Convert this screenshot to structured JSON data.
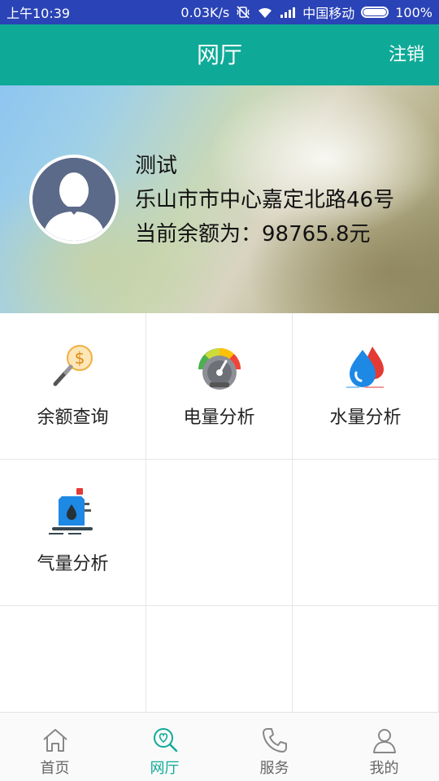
{
  "status_bar": {
    "time": "上午10:39",
    "speed": "0.03K/s",
    "carrier": "中国移动",
    "battery": "100%"
  },
  "header": {
    "title": "网厅",
    "logout_label": "注销"
  },
  "user": {
    "name": "测试",
    "address": "乐山市市中心嘉定北路46号",
    "balance_text": "当前余额为：98765.8元"
  },
  "services": [
    {
      "label": "余额查询",
      "icon": "magnifier-dollar-icon"
    },
    {
      "label": "电量分析",
      "icon": "gauge-icon"
    },
    {
      "label": "水量分析",
      "icon": "water-drops-icon"
    },
    {
      "label": "气量分析",
      "icon": "gas-tank-icon"
    }
  ],
  "tabs": [
    {
      "label": "首页",
      "icon": "home-icon",
      "active": false
    },
    {
      "label": "网厅",
      "icon": "search-heart-icon",
      "active": true
    },
    {
      "label": "服务",
      "icon": "phone-icon",
      "active": false
    },
    {
      "label": "我的",
      "icon": "person-icon",
      "active": false
    }
  ],
  "colors": {
    "status_bar": "#2a43b6",
    "brand": "#0faa97",
    "tab_inactive": "#666666"
  }
}
